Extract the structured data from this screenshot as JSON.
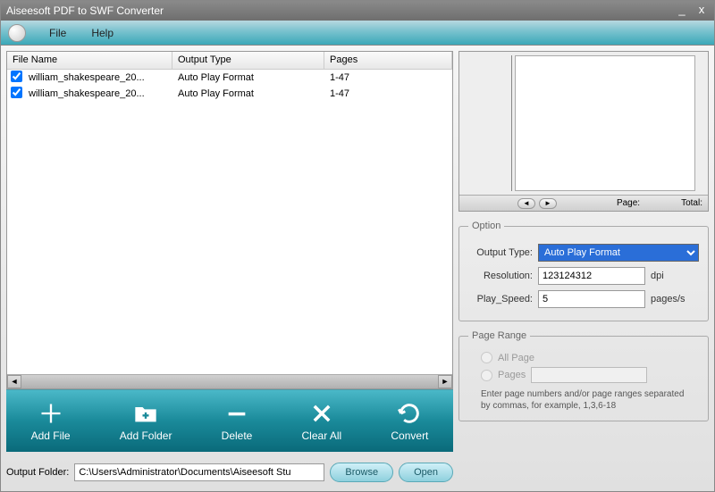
{
  "window": {
    "title": "Aiseesoft PDF to SWF Converter"
  },
  "menu": {
    "file": "File",
    "help": "Help"
  },
  "table": {
    "headers": {
      "name": "File Name",
      "type": "Output Type",
      "pages": "Pages"
    },
    "rows": [
      {
        "checked": true,
        "name": "william_shakespeare_20...",
        "type": "Auto Play Format",
        "pages": "1-47"
      },
      {
        "checked": true,
        "name": "william_shakespeare_20...",
        "type": "Auto Play Format",
        "pages": "1-47"
      }
    ]
  },
  "toolbar": {
    "add_file": "Add File",
    "add_folder": "Add Folder",
    "delete": "Delete",
    "clear_all": "Clear All",
    "convert": "Convert"
  },
  "output": {
    "label": "Output Folder:",
    "path": "C:\\Users\\Administrator\\Documents\\Aiseesoft Stu",
    "browse": "Browse",
    "open": "Open"
  },
  "preview": {
    "page_label": "Page:",
    "total_label": "Total:"
  },
  "option": {
    "legend": "Option",
    "output_type_label": "Output Type:",
    "output_type_value": "Auto Play Format",
    "resolution_label": "Resolution:",
    "resolution_value": "123124312",
    "resolution_unit": "dpi",
    "play_speed_label": "Play_Speed:",
    "play_speed_value": "5",
    "play_speed_unit": "pages/s"
  },
  "page_range": {
    "legend": "Page Range",
    "all_page": "All Page",
    "pages": "Pages",
    "hint": "Enter page numbers and/or page ranges separated by commas, for example, 1,3,6-18"
  }
}
